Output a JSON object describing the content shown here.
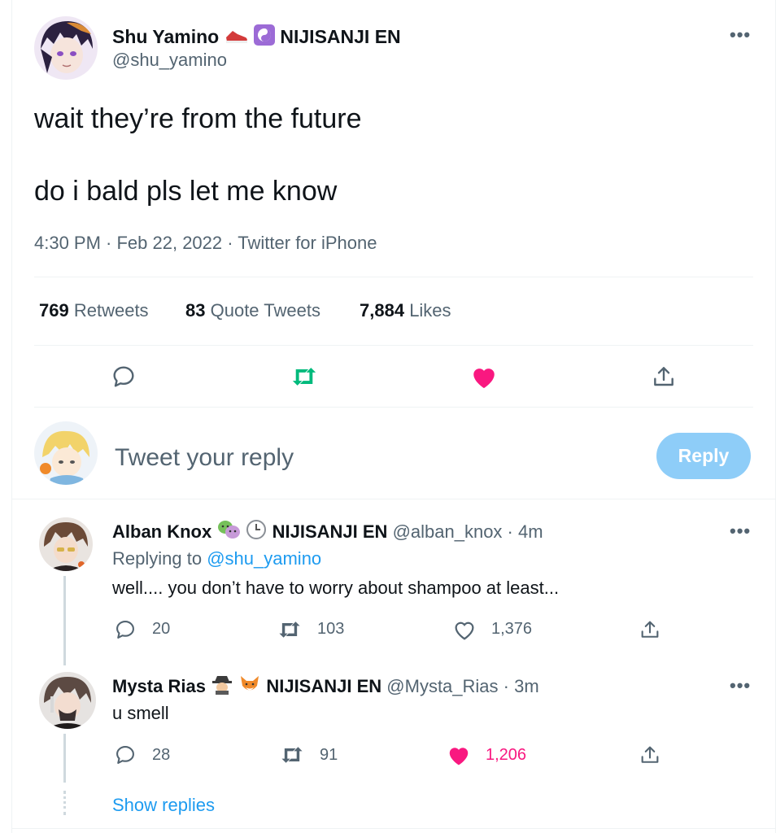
{
  "main_tweet": {
    "author_name": "Shu Yamino",
    "org": "NIJISANJI EN",
    "handle": "@shu_yamino",
    "text_line1": "wait they’re from the future",
    "text_line2": "do i bald pls let me know",
    "meta": "4:30 PM · Feb 22, 2022 · Twitter for iPhone",
    "retweets_count": "769",
    "retweets_label": "Retweets",
    "quotes_count": "83",
    "quotes_label": "Quote Tweets",
    "likes_count": "7,884",
    "likes_label": "Likes"
  },
  "composer": {
    "placeholder": "Tweet your reply",
    "reply_label": "Reply"
  },
  "replies": [
    {
      "author_name": "Alban Knox",
      "org": "NIJISANJI EN",
      "handle_time": "@alban_knox · 4m",
      "replying_prefix": "Replying to",
      "replying_to": "@shu_yamino",
      "text": "well.... you don’t have to worry about shampoo at least...",
      "replies": "20",
      "retweets": "103",
      "likes": "1,376"
    },
    {
      "author_name": "Mysta Rias",
      "org": "NIJISANJI EN",
      "handle_time": "@Mysta_Rias · 3m",
      "text": "u smell",
      "replies": "28",
      "retweets": "91",
      "likes": "1,206"
    }
  ],
  "show_replies": "Show replies",
  "colors": {
    "accent": "#1d9bf0",
    "retweet_green": "#00ba7c",
    "like_pink": "#f91880",
    "reply_button_disabled": "#8ecdf8",
    "muted_text": "#536471"
  }
}
